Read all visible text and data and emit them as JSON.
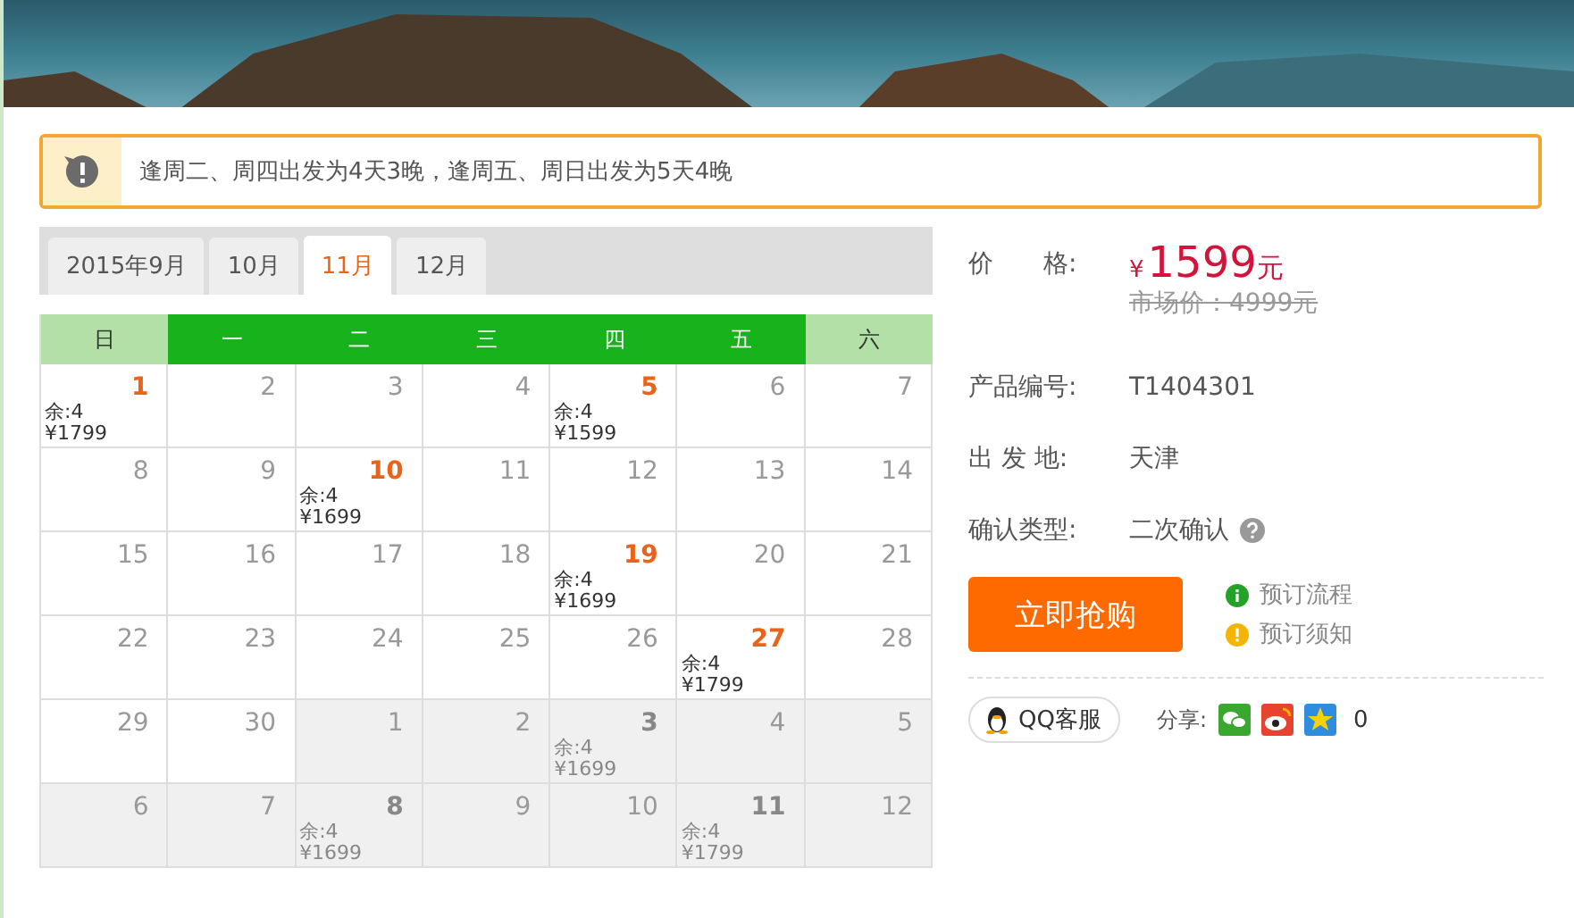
{
  "notice": {
    "text": "逢周二、周四出发为4天3晚，逢周五、周日出发为5天4晚"
  },
  "tabs": [
    {
      "label": "2015年9月",
      "selected": false
    },
    {
      "label": "10月",
      "selected": false
    },
    {
      "label": "11月",
      "selected": true
    },
    {
      "label": "12月",
      "selected": false
    }
  ],
  "weekdays": [
    {
      "label": "日",
      "weekend": true
    },
    {
      "label": "一",
      "weekend": false
    },
    {
      "label": "二",
      "weekend": false
    },
    {
      "label": "三",
      "weekend": false
    },
    {
      "label": "四",
      "weekend": false
    },
    {
      "label": "五",
      "weekend": false
    },
    {
      "label": "六",
      "weekend": true
    }
  ],
  "days": [
    {
      "day": "1",
      "other_month": false,
      "available": true,
      "remain": "余:4",
      "price": "¥1799"
    },
    {
      "day": "2",
      "other_month": false,
      "available": false
    },
    {
      "day": "3",
      "other_month": false,
      "available": false
    },
    {
      "day": "4",
      "other_month": false,
      "available": false
    },
    {
      "day": "5",
      "other_month": false,
      "available": true,
      "remain": "余:4",
      "price": "¥1599"
    },
    {
      "day": "6",
      "other_month": false,
      "available": false
    },
    {
      "day": "7",
      "other_month": false,
      "available": false
    },
    {
      "day": "8",
      "other_month": false,
      "available": false
    },
    {
      "day": "9",
      "other_month": false,
      "available": false
    },
    {
      "day": "10",
      "other_month": false,
      "available": true,
      "remain": "余:4",
      "price": "¥1699"
    },
    {
      "day": "11",
      "other_month": false,
      "available": false
    },
    {
      "day": "12",
      "other_month": false,
      "available": false
    },
    {
      "day": "13",
      "other_month": false,
      "available": false
    },
    {
      "day": "14",
      "other_month": false,
      "available": false
    },
    {
      "day": "15",
      "other_month": false,
      "available": false
    },
    {
      "day": "16",
      "other_month": false,
      "available": false
    },
    {
      "day": "17",
      "other_month": false,
      "available": false
    },
    {
      "day": "18",
      "other_month": false,
      "available": false
    },
    {
      "day": "19",
      "other_month": false,
      "available": true,
      "remain": "余:4",
      "price": "¥1699"
    },
    {
      "day": "20",
      "other_month": false,
      "available": false
    },
    {
      "day": "21",
      "other_month": false,
      "available": false
    },
    {
      "day": "22",
      "other_month": false,
      "available": false
    },
    {
      "day": "23",
      "other_month": false,
      "available": false
    },
    {
      "day": "24",
      "other_month": false,
      "available": false
    },
    {
      "day": "25",
      "other_month": false,
      "available": false
    },
    {
      "day": "26",
      "other_month": false,
      "available": false
    },
    {
      "day": "27",
      "other_month": false,
      "available": true,
      "remain": "余:4",
      "price": "¥1799"
    },
    {
      "day": "28",
      "other_month": false,
      "available": false
    },
    {
      "day": "29",
      "other_month": false,
      "available": false
    },
    {
      "day": "30",
      "other_month": false,
      "available": false
    },
    {
      "day": "1",
      "other_month": true,
      "available": false
    },
    {
      "day": "2",
      "other_month": true,
      "available": false
    },
    {
      "day": "3",
      "other_month": true,
      "available": true,
      "remain": "余:4",
      "price": "¥1699"
    },
    {
      "day": "4",
      "other_month": true,
      "available": false
    },
    {
      "day": "5",
      "other_month": true,
      "available": false
    },
    {
      "day": "6",
      "other_month": true,
      "available": false
    },
    {
      "day": "7",
      "other_month": true,
      "available": false
    },
    {
      "day": "8",
      "other_month": true,
      "available": true,
      "remain": "余:4",
      "price": "¥1699"
    },
    {
      "day": "9",
      "other_month": true,
      "available": false
    },
    {
      "day": "10",
      "other_month": true,
      "available": false
    },
    {
      "day": "11",
      "other_month": true,
      "available": true,
      "remain": "余:4",
      "price": "¥1799"
    },
    {
      "day": "12",
      "other_month": true,
      "available": false
    }
  ],
  "price": {
    "label": "价　　格:",
    "currency": "¥",
    "amount": "1599",
    "unit": "元",
    "market_price": "市场价：4999元"
  },
  "details": [
    {
      "label": "产品编号:",
      "value": "T1404301",
      "help": false
    },
    {
      "label": "出 发 地:",
      "value": "天津",
      "help": false
    },
    {
      "label": "确认类型:",
      "value": "二次确认",
      "help": true
    }
  ],
  "buy_button": "立即抢购",
  "links": [
    {
      "kind": "info",
      "label": "预订流程"
    },
    {
      "kind": "warning",
      "label": "预订须知"
    }
  ],
  "service_button": "QQ客服",
  "share": {
    "label": "分享:",
    "count": "0"
  }
}
